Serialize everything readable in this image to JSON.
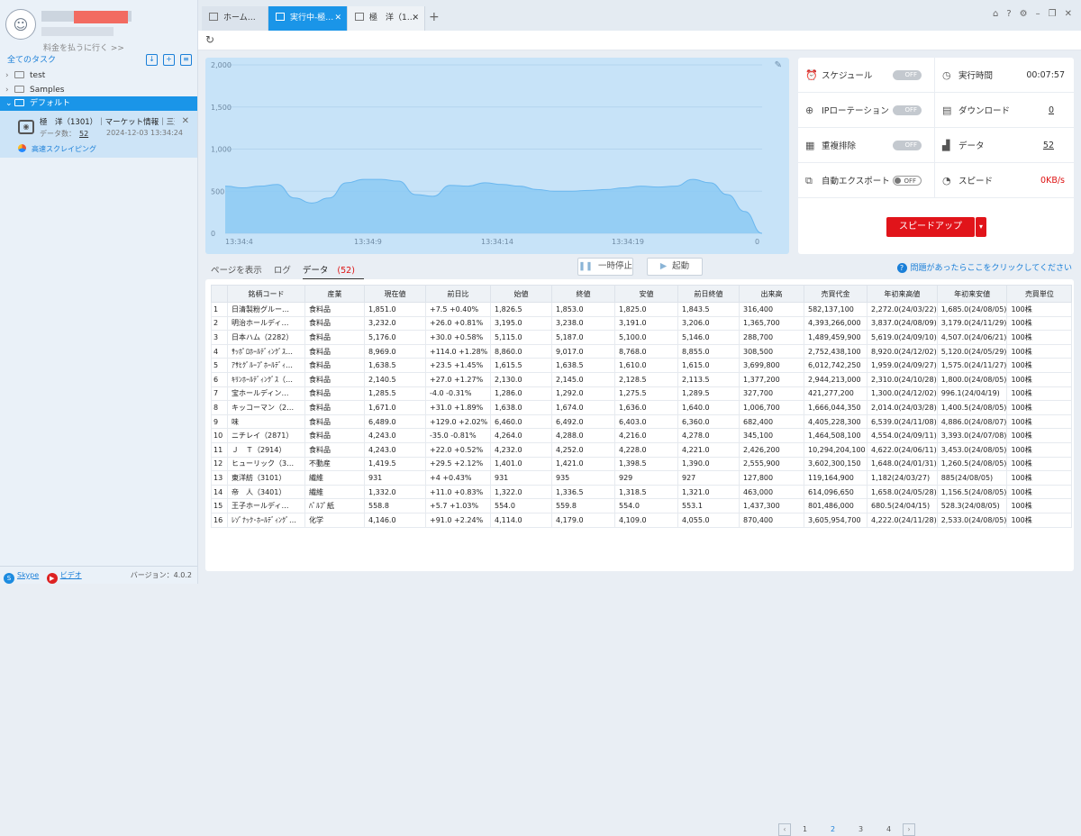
{
  "sidebar": {
    "pay_link": "料金を払うに行く >>",
    "all_tasks": "全てのタスク",
    "tree": [
      {
        "label": "test"
      },
      {
        "label": "Samples"
      },
      {
        "label": "デフォルト"
      }
    ],
    "task": {
      "title": "極　洋（1301）｜マーケット情報｜三菱…",
      "data_label": "データ数：",
      "data_count": "52",
      "time": "2024-12-03 13:34:24",
      "mode": "高速スクレイピング"
    },
    "footer": {
      "skype": "Skype",
      "video": "ビデオ",
      "version": "バージョン：4.0.2"
    }
  },
  "tabs": [
    {
      "label": "ホーム…"
    },
    {
      "label": "実行中-極…"
    },
    {
      "label": "極　洋（1…"
    }
  ],
  "chart_data": {
    "type": "area",
    "x": [
      "13:34:4",
      "13:34:9",
      "13:34:14",
      "13:34:19",
      "0"
    ],
    "y_ticks": [
      0,
      500,
      1000,
      1500,
      2000
    ],
    "ylim": [
      0,
      2000
    ],
    "values": [
      560,
      540,
      560,
      580,
      420,
      360,
      420,
      600,
      640,
      640,
      620,
      460,
      440,
      570,
      560,
      600,
      580,
      560,
      520,
      500,
      500,
      510,
      520,
      540,
      560,
      550,
      560,
      640,
      600,
      460,
      260,
      0
    ],
    "color": "#8ccaf3"
  },
  "status": {
    "schedule": {
      "label": "スケジュール",
      "toggle": "OFF"
    },
    "run_time": {
      "label": "実行時間",
      "value": "00:07:57"
    },
    "ip_rotation": {
      "label": "IPローテーション",
      "toggle": "OFF"
    },
    "download": {
      "label": "ダウンロード",
      "value": "0"
    },
    "dedupe": {
      "label": "重複排除",
      "toggle": "OFF"
    },
    "data": {
      "label": "データ",
      "value": "52"
    },
    "auto_export": {
      "label": "自動エクスポート",
      "toggle": "OFF"
    },
    "speed": {
      "label": "スピード",
      "value": "0KB/s"
    },
    "speed_up": "スピードアップ"
  },
  "view_tabs": {
    "page": "ページを表示",
    "log": "ログ",
    "data": "データ",
    "count": "(52)"
  },
  "buttons": {
    "pause": "一時停止",
    "start": "起動"
  },
  "help": "問題があったらここをクリックしてください",
  "table": {
    "headers": [
      "",
      "銘柄コード",
      "産業",
      "現在値",
      "前日比",
      "始値",
      "終値",
      "安値",
      "前日終値",
      "出来高",
      "売買代金",
      "年初来高値",
      "年初来安値",
      "売買単位"
    ],
    "rows": [
      [
        "1",
        "日清製粉グルー…",
        "食料品",
        "1,851.0",
        "+7.5 +0.40%",
        "1,826.5",
        "1,853.0",
        "1,825.0",
        "1,843.5",
        "316,400",
        "582,137,100",
        "2,272.0(24/03/22)",
        "1,685.0(24/08/05)",
        "100株"
      ],
      [
        "2",
        "明治ホールディ…",
        "食料品",
        "3,232.0",
        "+26.0 +0.81%",
        "3,195.0",
        "3,238.0",
        "3,191.0",
        "3,206.0",
        "1,365,700",
        "4,393,266,000",
        "3,837.0(24/08/09)",
        "3,179.0(24/11/29)",
        "100株"
      ],
      [
        "3",
        "日本ハム（2282）",
        "食料品",
        "5,176.0",
        "+30.0 +0.58%",
        "5,115.0",
        "5,187.0",
        "5,100.0",
        "5,146.0",
        "288,700",
        "1,489,459,900",
        "5,619.0(24/09/10)",
        "4,507.0(24/06/21)",
        "100株"
      ],
      [
        "4",
        "ｻｯﾎﾟﾛﾎｰﾙﾃﾞｨﾝｸﾞｽ…",
        "食料品",
        "8,969.0",
        "+114.0 +1.28%",
        "8,860.0",
        "9,017.0",
        "8,768.0",
        "8,855.0",
        "308,500",
        "2,752,438,100",
        "8,920.0(24/12/02)",
        "5,120.0(24/05/29)",
        "100株"
      ],
      [
        "5",
        "ｱｻﾋｸﾞﾙｰﾌﾟﾎｰﾙﾃﾞｨ…",
        "食料品",
        "1,638.5",
        "+23.5 +1.45%",
        "1,615.5",
        "1,638.5",
        "1,610.0",
        "1,615.0",
        "3,699,800",
        "6,012,742,250",
        "1,959.0(24/09/27)",
        "1,575.0(24/11/27)",
        "100株"
      ],
      [
        "6",
        "ｷﾘﾝﾎｰﾙﾃﾞｨﾝｸﾞｽ（…",
        "食料品",
        "2,140.5",
        "+27.0 +1.27%",
        "2,130.0",
        "2,145.0",
        "2,128.5",
        "2,113.5",
        "1,377,200",
        "2,944,213,000",
        "2,310.0(24/10/28)",
        "1,800.0(24/08/05)",
        "100株"
      ],
      [
        "7",
        "宝ホールディン…",
        "食料品",
        "1,285.5",
        "-4.0 -0.31%",
        "1,286.0",
        "1,292.0",
        "1,275.5",
        "1,289.5",
        "327,700",
        "421,277,200",
        "1,300.0(24/12/02)",
        "996.1(24/04/19)",
        "100株"
      ],
      [
        "8",
        "キッコーマン（2…",
        "食料品",
        "1,671.0",
        "+31.0 +1.89%",
        "1,638.0",
        "1,674.0",
        "1,636.0",
        "1,640.0",
        "1,006,700",
        "1,666,044,350",
        "2,014.0(24/03/28)",
        "1,400.5(24/08/05)",
        "100株"
      ],
      [
        "9",
        "味",
        "食料品",
        "6,489.0",
        "+129.0 +2.02%",
        "6,460.0",
        "6,492.0",
        "6,403.0",
        "6,360.0",
        "682,400",
        "4,405,228,300",
        "6,539.0(24/11/08)",
        "4,886.0(24/08/07)",
        "100株"
      ],
      [
        "10",
        "ニチレイ（2871）",
        "食料品",
        "4,243.0",
        "-35.0 -0.81%",
        "4,264.0",
        "4,288.0",
        "4,216.0",
        "4,278.0",
        "345,100",
        "1,464,508,100",
        "4,554.0(24/09/11)",
        "3,393.0(24/07/08)",
        "100株"
      ],
      [
        "11",
        "Ｊ　Ｔ（2914）",
        "食料品",
        "4,243.0",
        "+22.0 +0.52%",
        "4,232.0",
        "4,252.0",
        "4,228.0",
        "4,221.0",
        "2,426,200",
        "10,294,204,100",
        "4,622.0(24/06/11)",
        "3,453.0(24/08/05)",
        "100株"
      ],
      [
        "12",
        "ヒューリック（3…",
        "不動産",
        "1,419.5",
        "+29.5 +2.12%",
        "1,401.0",
        "1,421.0",
        "1,398.5",
        "1,390.0",
        "2,555,900",
        "3,602,300,150",
        "1,648.0(24/01/31)",
        "1,260.5(24/08/05)",
        "100株"
      ],
      [
        "13",
        "東洋紡（3101）",
        "繊維",
        "931",
        "+4 +0.43%",
        "931",
        "935",
        "929",
        "927",
        "127,800",
        "119,164,900",
        "1,182(24/03/27)",
        "885(24/08/05)",
        "100株"
      ],
      [
        "14",
        "帝　人（3401）",
        "繊維",
        "1,332.0",
        "+11.0 +0.83%",
        "1,322.0",
        "1,336.5",
        "1,318.5",
        "1,321.0",
        "463,000",
        "614,096,650",
        "1,658.0(24/05/28)",
        "1,156.5(24/08/05)",
        "100株"
      ],
      [
        "15",
        "王子ホールディ…",
        "ﾊﾟﾙﾌﾟ紙",
        "558.8",
        "+5.7 +1.03%",
        "554.0",
        "559.8",
        "554.0",
        "553.1",
        "1,437,300",
        "801,486,000",
        "680.5(24/04/15)",
        "528.3(24/08/05)",
        "100株"
      ],
      [
        "16",
        "ﾚｿﾞﾅｯｸ･ﾎｰﾙﾃﾞｨﾝｸﾞ…",
        "化学",
        "4,146.0",
        "+91.0 +2.24%",
        "4,114.0",
        "4,179.0",
        "4,109.0",
        "4,055.0",
        "870,400",
        "3,605,954,700",
        "4,222.0(24/11/28)",
        "2,533.0(24/08/05)",
        "100株"
      ]
    ]
  },
  "pager": {
    "pages": [
      "1",
      "2",
      "3",
      "4"
    ],
    "current": "2"
  }
}
